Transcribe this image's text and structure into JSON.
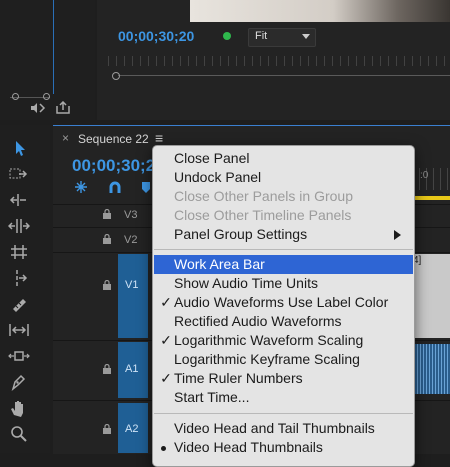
{
  "program_monitor": {
    "timecode": "00;00;30;20",
    "zoom": "Fit",
    "status_color": "#2fb84d"
  },
  "sequence": {
    "tab_name": "Sequence 22",
    "close": "×",
    "menu_icon": "≡",
    "timecode": "00;00;30;2"
  },
  "tracks": [
    {
      "label": "V3"
    },
    {
      "label": "V2"
    },
    {
      "label": "V1"
    },
    {
      "label": "A1"
    },
    {
      "label": "A2"
    }
  ],
  "timeline": {
    "clip_label_fragment": "4]"
  },
  "tools": [
    "selection-tool",
    "track-select-tool",
    "ripple-edit-tool",
    "rolling-edit-tool",
    "rate-stretch-tool",
    "razor-tool",
    "slip-tool",
    "slide-tool",
    "pen-tool",
    "hand-tool",
    "zoom-tool"
  ],
  "context_menu": {
    "items": [
      {
        "label": "Close Panel",
        "enabled": true
      },
      {
        "label": "Undock Panel",
        "enabled": true
      },
      {
        "label": "Close Other Panels in Group",
        "enabled": false
      },
      {
        "label": "Close Other Timeline Panels",
        "enabled": false
      },
      {
        "label": "Panel Group Settings",
        "enabled": true,
        "submenu": true
      },
      {
        "label": "Work Area Bar",
        "enabled": true,
        "highlighted": true
      },
      {
        "label": "Show Audio Time Units",
        "enabled": true
      },
      {
        "label": "Audio Waveforms Use Label Color",
        "enabled": true,
        "checked": true
      },
      {
        "label": "Rectified Audio Waveforms",
        "enabled": true
      },
      {
        "label": "Logarithmic Waveform Scaling",
        "enabled": true,
        "checked": true
      },
      {
        "label": "Logarithmic Keyframe Scaling",
        "enabled": true
      },
      {
        "label": "Time Ruler Numbers",
        "enabled": true,
        "checked": true
      },
      {
        "label": "Start Time...",
        "enabled": true
      },
      {
        "label": "Video Head and Tail Thumbnails",
        "enabled": true
      },
      {
        "label": "Video Head Thumbnails",
        "enabled": true,
        "selected": true
      }
    ],
    "check_glyph": "✓"
  },
  "colors": {
    "accent_blue": "#3d96e3",
    "highlight": "#2e65d4",
    "clip_blue": "#1f5f95",
    "menu_bg": "#e4e4e4"
  }
}
